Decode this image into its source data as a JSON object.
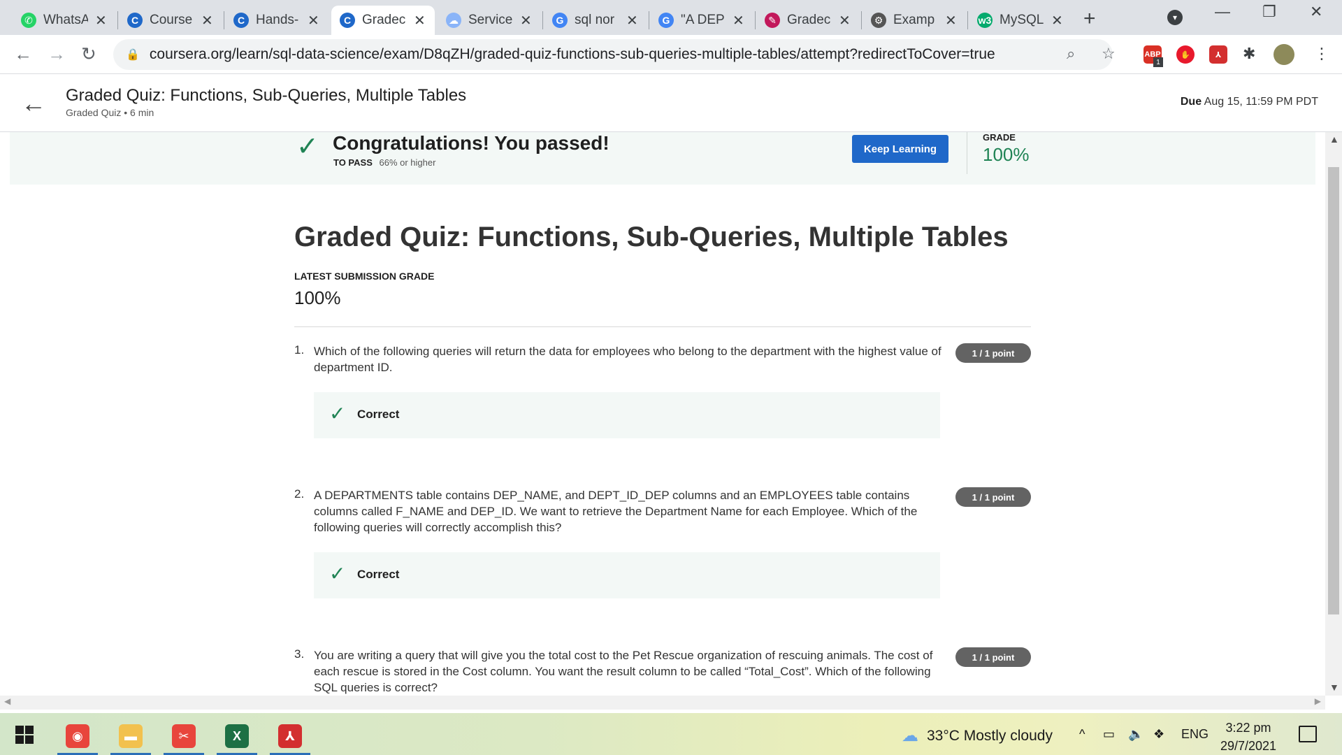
{
  "browser": {
    "tabs": [
      {
        "label": "WhatsA",
        "icon": "whatsapp-icon",
        "color": "#25d366",
        "glyph": "✆"
      },
      {
        "label": "Course",
        "icon": "coursera-icon",
        "color": "#1f68c9",
        "glyph": "C"
      },
      {
        "label": "Hands-",
        "icon": "coursera-icon",
        "color": "#1f68c9",
        "glyph": "C"
      },
      {
        "label": "Gradec",
        "icon": "coursera-icon",
        "color": "#1f68c9",
        "glyph": "C"
      },
      {
        "label": "Service",
        "icon": "cloud-icon",
        "color": "#8ab4f8",
        "glyph": "☁"
      },
      {
        "label": "sql nor",
        "icon": "google-icon",
        "color": "#4285f4",
        "glyph": "G"
      },
      {
        "label": "\"A DEP",
        "icon": "google-icon",
        "color": "#4285f4",
        "glyph": "G"
      },
      {
        "label": "Gradec",
        "icon": "graded-site-icon",
        "color": "#c2185b",
        "glyph": "✎"
      },
      {
        "label": "Examp",
        "icon": "bike-icon",
        "color": "#555555",
        "glyph": "⚙"
      },
      {
        "label": "MySQL",
        "icon": "w3schools-icon",
        "color": "#04aa6d",
        "glyph": "w3"
      }
    ],
    "active_tab": 3,
    "url": "coursera.org/learn/sql-data-science/exam/D8qZH/graded-quiz-functions-sub-queries-multiple-tables/attempt?redirectToCover=true",
    "extension_badge": "1",
    "extensions": [
      {
        "name": "abp-extension-icon",
        "label": "ABP",
        "color": "#d93025"
      },
      {
        "name": "stop-extension-icon",
        "label": "✋",
        "color": "#e8192c"
      },
      {
        "name": "pdf-extension-icon",
        "label": "⅄",
        "color": "#d32f2f"
      }
    ]
  },
  "header": {
    "title": "Graded Quiz: Functions, Sub-Queries, Multiple Tables",
    "subtitle": "Graded Quiz • 6 min",
    "due_label": "Due",
    "due_value": "Aug 15, 11:59 PM PDT"
  },
  "banner": {
    "message": "Congratulations! You passed!",
    "to_pass_label": "TO PASS",
    "to_pass_value": "66% or higher",
    "keep_learning": "Keep Learning",
    "grade_label": "GRADE",
    "grade_value": "100%",
    "accent": "#1f8354"
  },
  "main": {
    "title": "Graded Quiz: Functions, Sub-Queries, Multiple Tables",
    "latest_label": "LATEST SUBMISSION GRADE",
    "latest_value": "100%",
    "questions": [
      {
        "num": "1.",
        "text": "Which of the following queries will return the data for employees who belong to the department with the highest value of department ID.",
        "score": "1 / 1 point",
        "result": "Correct"
      },
      {
        "num": "2.",
        "text": "A DEPARTMENTS table contains DEP_NAME, and DEPT_ID_DEP columns and an EMPLOYEES table contains columns called F_NAME and DEP_ID. We want to retrieve the Department Name for each Employee. Which of the following queries will correctly accomplish this?",
        "score": "1 / 1 point",
        "result": "Correct"
      },
      {
        "num": "3.",
        "text": "You are writing a query that will give you the total cost to the Pet Rescue organization of rescuing animals. The cost of each rescue is stored in the Cost column. You want the result column to be called “Total_Cost”. Which of the following SQL queries is correct?",
        "score": "1 / 1 point"
      }
    ]
  },
  "taskbar": {
    "apps": [
      {
        "name": "chrome-app",
        "color": "#e8453c",
        "label": "◉"
      },
      {
        "name": "file-explorer-app",
        "color": "#f2c14e",
        "label": "▬"
      },
      {
        "name": "snip-app",
        "color": "#e8453c",
        "label": "✂"
      },
      {
        "name": "excel-app",
        "color": "#1d7044",
        "label": "X"
      },
      {
        "name": "acrobat-app",
        "color": "#d32f2f",
        "label": "⅄"
      }
    ],
    "weather": "33°C  Mostly cloudy",
    "language": "ENG",
    "time": "3:22 pm",
    "date": "29/7/2021"
  }
}
